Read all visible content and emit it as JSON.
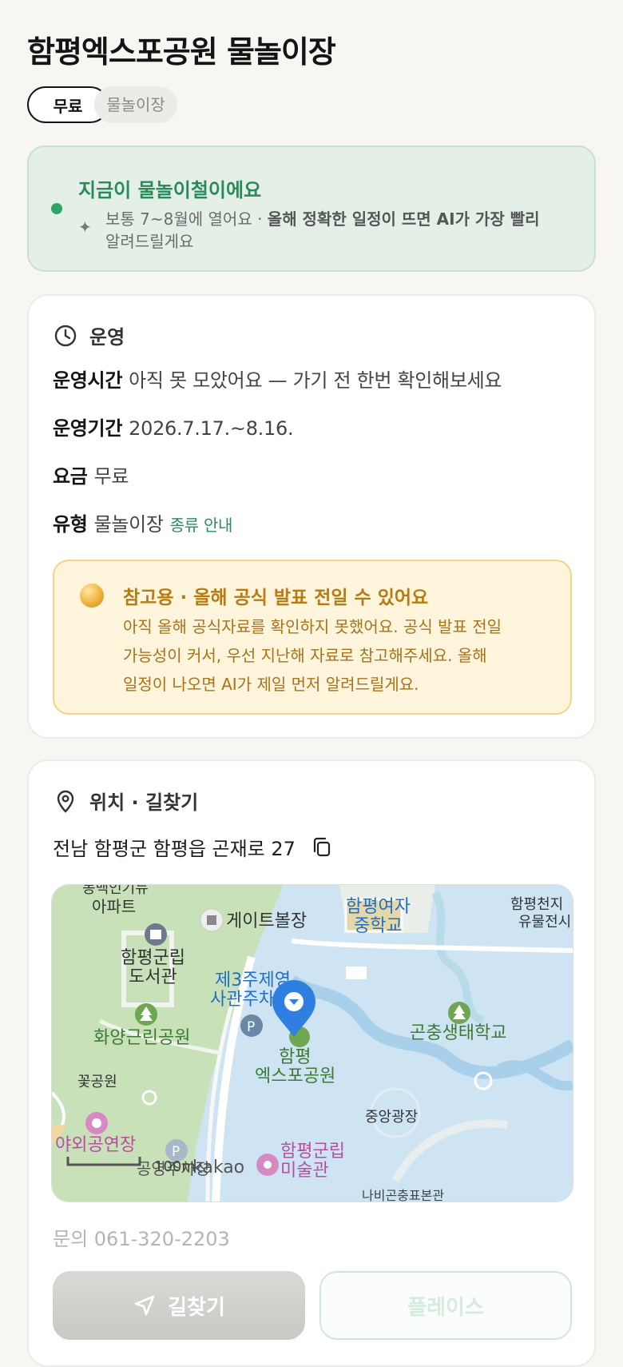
{
  "header": {
    "title": "함평엑스포공원 물놀이장"
  },
  "chips": {
    "primary": "무료",
    "secondary": "물놀이장"
  },
  "season": {
    "headline": "지금이 물놀이철이에요",
    "desc_lead": "보통 7~8월에 열어요 · ",
    "desc_bold": "올해 정확한 일정이 뜨면 AI가 가장 빨리",
    "desc_tail": "알려드릴게요"
  },
  "operation": {
    "heading": "운영",
    "hours_label": "운영시간",
    "hours_value": "아직 못 모았어요 — 가기 전 한번 확인해보세요",
    "period_label": "운영기간",
    "period_value": "2026.7.17.~8.16.",
    "fee_label": "요금",
    "fee_value": "무료",
    "type_label": "유형",
    "type_value": "물놀이장",
    "type_link": "종류 안내"
  },
  "notice": {
    "title": "참고용 · 올해 공식 발표 전일 수 있어요",
    "line1": "아직 올해 공식자료를 확인하지 못했어요. 공식 발표 전일",
    "line2": "가능성이 커서, 우선 지난해 자료로 참고해주세요. 올해",
    "line3": "일정이 나오면 AI가 제일 먼저 알려드릴게요."
  },
  "location": {
    "heading": "위치 · 길찾기",
    "address": "전남 함평군 함평읍 곤재로 27",
    "inquiry": "문의 061-320-2203"
  },
  "map": {
    "labels": {
      "apt": "아파트",
      "apt_partial": "동백인기뉴",
      "gateball": "게이트볼장",
      "girls_school_1": "함평여자",
      "girls_school_2": "중학교",
      "relic_1": "함평천지",
      "relic_2": "유물전시",
      "library_1": "함평군립",
      "library_2": "도서관",
      "parking_1": "제3주제영",
      "parking_2": "사관주차장",
      "hwayang_park": "화양근린공원",
      "expo_1": "함평",
      "expo_2": "엑스포공원",
      "insect_school": "곤충생태학교",
      "flower_garden": "꽃공원",
      "outdoor_stage": "야외공연장",
      "central_plaza": "중앙광장",
      "art_1": "함평군립",
      "art_2": "미술관",
      "parking_bottom": "공영주차장",
      "butterfly": "나비곤충표본관",
      "scale": "100m",
      "brand": "kakao"
    },
    "colors": {
      "green": "#c9e1b8",
      "water": "#cfe4f3",
      "accent": "#2b8a5a",
      "marker": "#2f7fe0"
    }
  },
  "buttons": {
    "route": "길찾기",
    "place": "플레이스"
  }
}
